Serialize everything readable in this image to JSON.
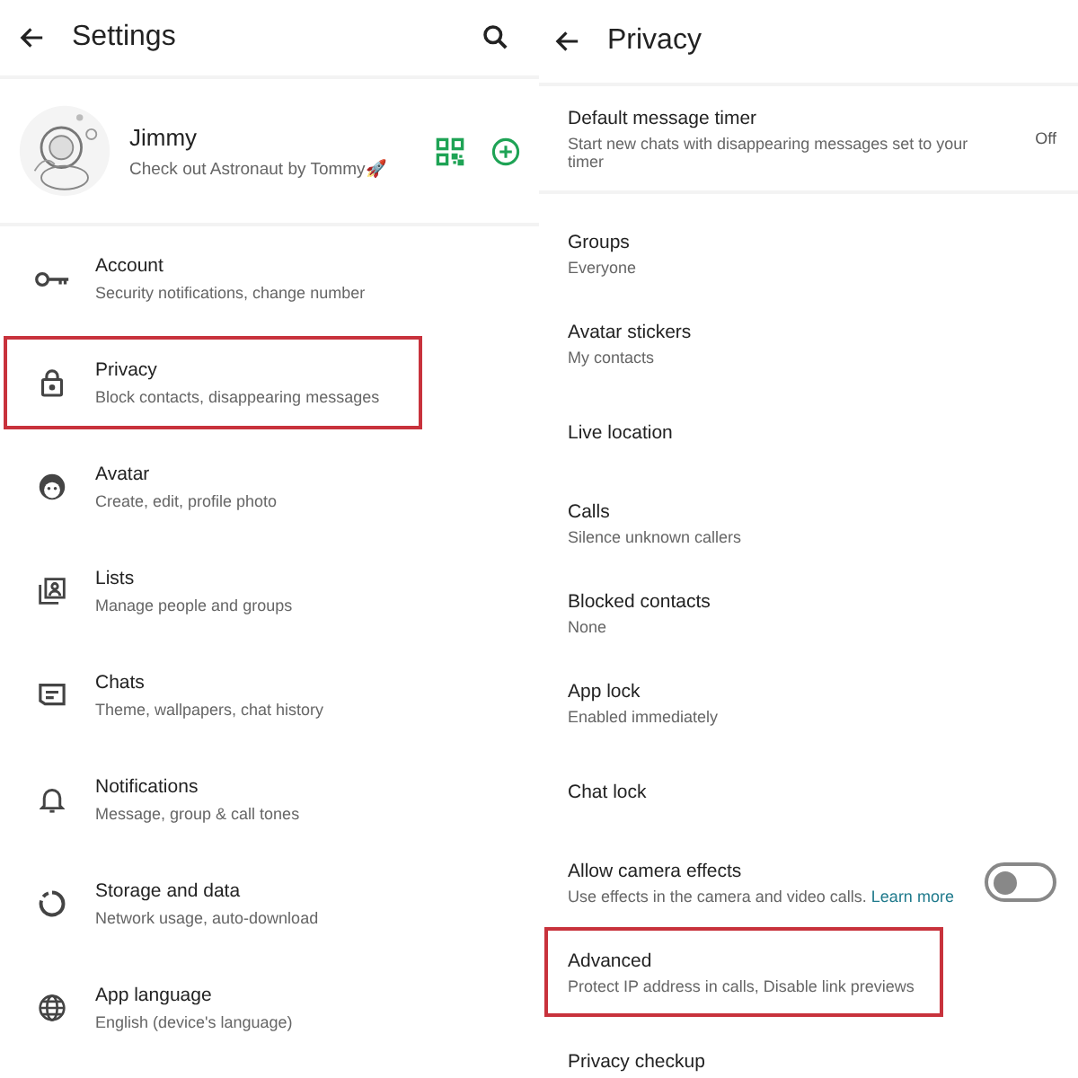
{
  "settings": {
    "title": "Settings",
    "profile": {
      "name": "Jimmy",
      "status": "Check out Astronaut by Tommy🚀"
    },
    "items": [
      {
        "title": "Account",
        "subtitle": "Security notifications, change number",
        "highlighted": false
      },
      {
        "title": "Privacy",
        "subtitle": "Block contacts, disappearing messages",
        "highlighted": true
      },
      {
        "title": "Avatar",
        "subtitle": "Create, edit, profile photo",
        "highlighted": false
      },
      {
        "title": "Lists",
        "subtitle": "Manage people and groups",
        "highlighted": false
      },
      {
        "title": "Chats",
        "subtitle": "Theme, wallpapers, chat history",
        "highlighted": false
      },
      {
        "title": "Notifications",
        "subtitle": "Message, group & call tones",
        "highlighted": false
      },
      {
        "title": "Storage and data",
        "subtitle": "Network usage, auto-download",
        "highlighted": false
      },
      {
        "title": "App language",
        "subtitle": "English (device's language)",
        "highlighted": false
      }
    ]
  },
  "privacy": {
    "title": "Privacy",
    "items": [
      {
        "kind": "value",
        "title": "Default message timer",
        "subtitle": "Start new chats with disappearing messages set to your timer",
        "value": "Off"
      },
      {
        "kind": "text",
        "title": "Groups",
        "subtitle": "Everyone",
        "highlighted": false
      },
      {
        "kind": "text",
        "title": "Avatar stickers",
        "subtitle": "My contacts",
        "highlighted": false
      },
      {
        "kind": "text",
        "title": "Live location",
        "highlighted": false
      },
      {
        "kind": "text",
        "title": "Calls",
        "subtitle": "Silence unknown callers",
        "highlighted": false
      },
      {
        "kind": "text",
        "title": "Blocked contacts",
        "subtitle": "None",
        "highlighted": false
      },
      {
        "kind": "text",
        "title": "App lock",
        "subtitle": "Enabled immediately",
        "highlighted": false
      },
      {
        "kind": "text",
        "title": "Chat lock",
        "highlighted": false
      },
      {
        "kind": "toggle",
        "title": "Allow camera effects",
        "subtitle": "Use effects in the camera and video calls.",
        "link": "Learn more",
        "on": false
      },
      {
        "kind": "text",
        "title": "Advanced",
        "subtitle": "Protect IP address in calls, Disable link previews",
        "highlighted": true
      },
      {
        "kind": "text",
        "title": "Privacy checkup",
        "highlighted": false
      }
    ]
  }
}
